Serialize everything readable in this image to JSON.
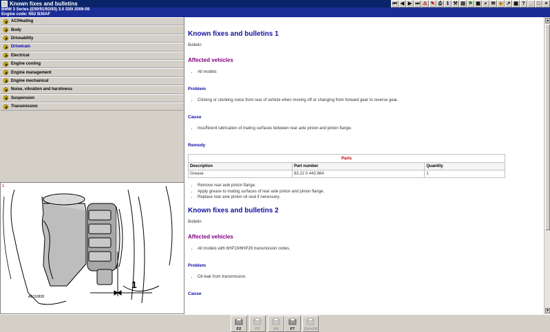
{
  "window": {
    "title": "Known fixes and bulletins"
  },
  "toolbar": {
    "icons": [
      "first-icon",
      "prev-icon",
      "next-icon",
      "last-icon",
      "warning-icon",
      "note-icon",
      "print-icon",
      "info-icon",
      "tools-icon",
      "book-icon",
      "flag-icon",
      "calc-icon",
      "search-icon",
      "mail-icon",
      "tag-icon",
      "arrow-icon",
      "grid-icon",
      "help-icon",
      "minimize-icon",
      "maximize-icon",
      "close-icon"
    ],
    "close_glyph": "×",
    "help_glyph": "?"
  },
  "vehicle": {
    "line1": "BMW   3 Series (E90/91/92/93) 3.0 330i 2006-08",
    "line2": "Engine code: N52 B30AF"
  },
  "categories": [
    {
      "label": "AC/Heating",
      "active": false
    },
    {
      "label": "Body",
      "active": false
    },
    {
      "label": "Driveability",
      "active": false
    },
    {
      "label": "Drivetrain",
      "active": true
    },
    {
      "label": "Electrical",
      "active": false
    },
    {
      "label": "Engine cooling",
      "active": false
    },
    {
      "label": "Engine management",
      "active": false
    },
    {
      "label": "Engine mechanical",
      "active": false
    },
    {
      "label": "Noise, vibration and harshness",
      "active": false
    },
    {
      "label": "Suspension",
      "active": false
    },
    {
      "label": "Transmission",
      "active": false
    }
  ],
  "figure": {
    "number": "1",
    "callout": "1",
    "code": "AB116838"
  },
  "bulletins": [
    {
      "title": "Known fixes and bulletins 1",
      "type": "Bulletin",
      "affected_heading": "Affected vehicles",
      "affected": [
        "All models"
      ],
      "problem_heading": "Problem",
      "problem": [
        "Clicking or clonking noise from rear of vehicle when moving off or changing from forward gear to reverse gear."
      ],
      "cause_heading": "Cause",
      "cause": [
        "Insufficient lubrication of mating surfaces between rear axle pinion and pinion flange."
      ],
      "remedy_heading": "Remedy",
      "parts": {
        "title": "Parts",
        "headers": [
          "Description",
          "Part number",
          "Quantity"
        ],
        "rows": [
          [
            "Grease",
            "83.22 0 443 864",
            "1"
          ]
        ]
      },
      "steps": [
        "Remove rear axle pinion flange.",
        "Apply grease to mating surfaces of rear axle pinion and pinion flange.",
        "Replace rear axle pinion oil seal if necessary."
      ]
    },
    {
      "title": "Known fixes and bulletins 2",
      "type": "Bulletin",
      "affected_heading": "Affected vehicles",
      "affected": [
        "All models with 6HP19/6HP26 transmission codes."
      ],
      "problem_heading": "Problem",
      "problem": [
        "Oil leak from transmission."
      ],
      "cause_heading": "Cause"
    }
  ],
  "function_keys": [
    {
      "label": "F2",
      "icon": "print-icon",
      "enabled": true
    },
    {
      "label": "F3",
      "icon": "print-preview-icon",
      "enabled": false
    },
    {
      "label": "F4",
      "icon": "export-icon",
      "enabled": false
    },
    {
      "label": "F7",
      "icon": "tools-icon",
      "enabled": true
    },
    {
      "label": "Ctrl+F4",
      "icon": "close-document-icon",
      "enabled": false
    }
  ]
}
